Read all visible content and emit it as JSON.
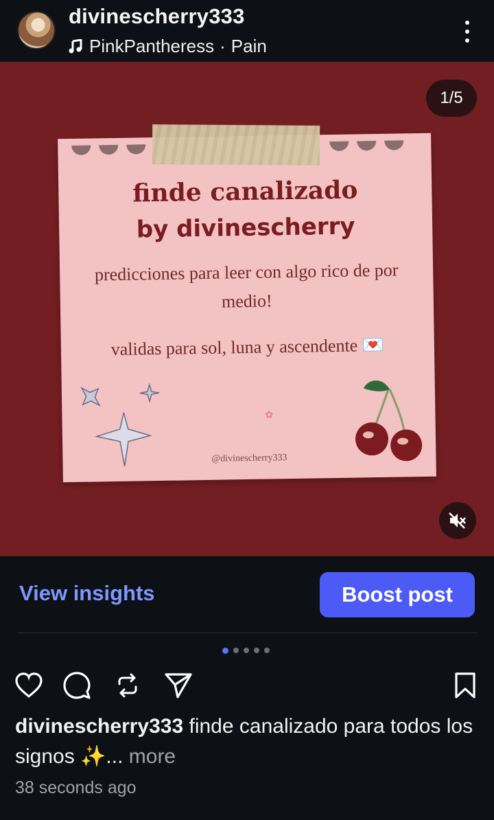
{
  "header": {
    "username": "divinescherry333",
    "music_artist": "PinkPantheress",
    "music_separator": "·",
    "music_track": "Pain",
    "avatar_icon": "profile-avatar",
    "more_icon": "more-vertical-icon"
  },
  "post": {
    "counter": "1/5",
    "mute_icon": "speaker-muted-icon",
    "background_color": "#731e22",
    "card_color": "#f3c2c2",
    "card": {
      "title": "finde canalizado",
      "subtitle": "by divinescherry",
      "body_line1": "predicciones para leer con algo rico de por medio!",
      "body_line2": "validas para sol, luna y ascendente",
      "envelope_emoji": "💌",
      "handle": "@divinescherry333"
    }
  },
  "actions": {
    "view_insights": "View insights",
    "boost_post": "Boost post",
    "accent_color": "#4c5bf6"
  },
  "carousel": {
    "total": 5,
    "active_index": 1
  },
  "icons": {
    "like": "heart-icon",
    "comment": "comment-icon",
    "repost": "repost-icon",
    "share": "send-icon",
    "save": "bookmark-icon"
  },
  "caption": {
    "username": "divinescherry333",
    "text": "finde canalizado para todos los signos ✨...",
    "more": "more"
  },
  "timestamp": "38 seconds ago"
}
